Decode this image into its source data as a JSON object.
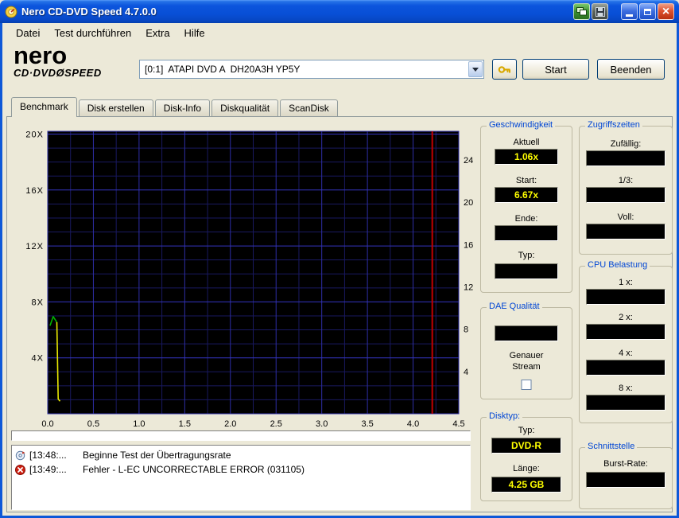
{
  "window": {
    "title": "Nero CD-DVD Speed 4.7.0.0"
  },
  "menu": {
    "items": [
      "Datei",
      "Test durchführen",
      "Extra",
      "Hilfe"
    ]
  },
  "toolbar": {
    "logo": {
      "line1": "nero",
      "line2": "CD·DVDØSPEED"
    },
    "drive_selector": {
      "value": "[0:1]  ATAPI DVD A  DH20A3H YP5Y"
    },
    "start_button": "Start",
    "quit_button": "Beenden"
  },
  "tabs": {
    "items": [
      "Benchmark",
      "Disk erstellen",
      "Disk-Info",
      "Diskqualität",
      "ScanDisk"
    ],
    "active": "Benchmark"
  },
  "chart_data": {
    "type": "line",
    "xlim": [
      0,
      4.5
    ],
    "ylim_left": [
      0,
      20.2
    ],
    "ylim_right": [
      0,
      26.7
    ],
    "x_ticks": [
      {
        "v": 0,
        "label": "0.0"
      },
      {
        "v": 0.5,
        "label": "0.5"
      },
      {
        "v": 1,
        "label": "1.0"
      },
      {
        "v": 1.5,
        "label": "1.5"
      },
      {
        "v": 2,
        "label": "2.0"
      },
      {
        "v": 2.5,
        "label": "2.5"
      },
      {
        "v": 3,
        "label": "3.0"
      },
      {
        "v": 3.5,
        "label": "3.5"
      },
      {
        "v": 4,
        "label": "4.0"
      },
      {
        "v": 4.5,
        "label": "4.5"
      }
    ],
    "y_left_ticks": [
      {
        "v": 20,
        "label": "20X"
      },
      {
        "v": 16,
        "label": "16X"
      },
      {
        "v": 12,
        "label": "12X"
      },
      {
        "v": 8,
        "label": "8X"
      },
      {
        "v": 4,
        "label": "4X"
      }
    ],
    "y_right_ticks": [
      {
        "v": 24,
        "label": "24"
      },
      {
        "v": 20,
        "label": "20"
      },
      {
        "v": 16,
        "label": "16"
      },
      {
        "v": 12,
        "label": "12"
      },
      {
        "v": 8,
        "label": "8"
      },
      {
        "v": 4,
        "label": "4"
      }
    ],
    "series": [
      {
        "name": "transfer-rate-start",
        "color": "#00b400",
        "points": [
          [
            0.025,
            6.3
          ],
          [
            0.06,
            6.95
          ],
          [
            0.1,
            6.55
          ]
        ]
      },
      {
        "name": "transfer-rate-drop",
        "color": "#e8e800",
        "points": [
          [
            0.1,
            6.55
          ],
          [
            0.115,
            1.05
          ],
          [
            0.135,
            0.9
          ]
        ]
      }
    ],
    "markers": [
      {
        "type": "vline",
        "x": 4.21,
        "color": "#c00000"
      }
    ],
    "grid": {
      "background": "#000000",
      "minor_color": "#191960",
      "major_v_color": "#2e2ea6",
      "major_h_color": "#3434c0",
      "minor_x_step": 0.25,
      "major_x_step": 0.5,
      "minor_y_step": 1,
      "major_y_step": 4
    }
  },
  "log": {
    "entries": [
      {
        "time": "[13:48:...",
        "message": "Beginne Test der Übertragungsrate",
        "icon": "start"
      },
      {
        "time": "[13:49:...",
        "message": "Fehler - L-EC UNCORRECTABLE ERROR (031105)",
        "icon": "error"
      }
    ]
  },
  "panels": {
    "geschwindigkeit": {
      "title": "Geschwindigkeit",
      "fields": [
        {
          "label": "Aktuell",
          "value": "1.06x"
        },
        {
          "label": "Start:",
          "value": "6.67x"
        },
        {
          "label": "Ende:",
          "value": ""
        },
        {
          "label": "Typ:",
          "value": ""
        }
      ]
    },
    "zugriffszeiten": {
      "title": "Zugriffszeiten",
      "fields": [
        {
          "label": "Zufällig:",
          "value": ""
        },
        {
          "label": "1/3:",
          "value": ""
        },
        {
          "label": "Voll:",
          "value": ""
        }
      ]
    },
    "cpu": {
      "title": "CPU Belastung",
      "fields": [
        {
          "label": "1 x:",
          "value": ""
        },
        {
          "label": "2 x:",
          "value": ""
        },
        {
          "label": "4 x:",
          "value": ""
        },
        {
          "label": "8 x:",
          "value": ""
        }
      ]
    },
    "dae": {
      "title": "DAE Qualität",
      "value": "",
      "line1": "Genauer",
      "line2": "Stream",
      "checked": false
    },
    "disktyp": {
      "title": "Disktyp:",
      "fields": [
        {
          "label": "Typ:",
          "value": "DVD-R"
        },
        {
          "label": "Länge:",
          "value": "4.25 GB"
        }
      ]
    },
    "schnittstelle": {
      "title": "Schnittstelle",
      "fields": [
        {
          "label": "Burst-Rate:",
          "value": ""
        }
      ]
    }
  },
  "colors": {
    "value_text": "#ffff00",
    "group_title": "#0046d5",
    "titlebar": "#0a50d6",
    "error": "#cc1f10"
  }
}
